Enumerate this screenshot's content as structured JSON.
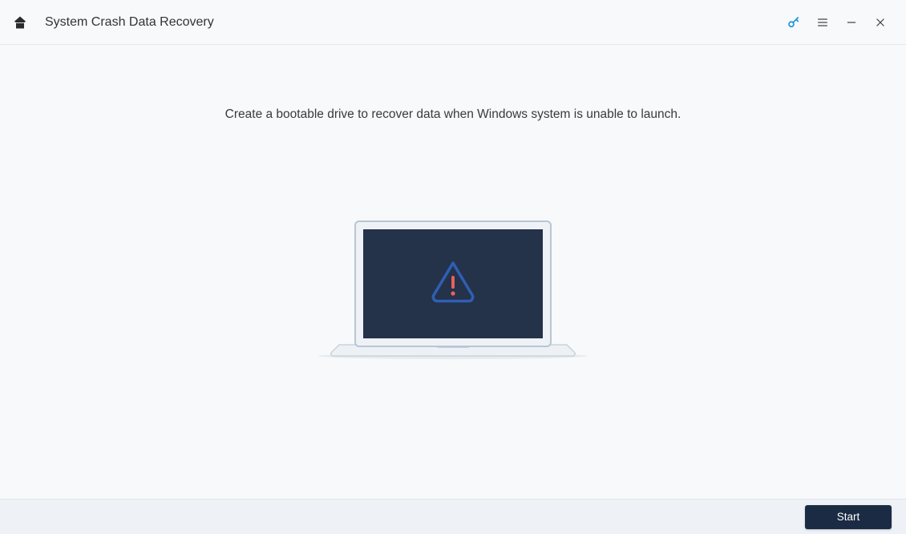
{
  "titlebar": {
    "title": "System Crash Data Recovery"
  },
  "main": {
    "subtitle": "Create a bootable drive to recover data when Windows system is unable to launch."
  },
  "footer": {
    "start_label": "Start"
  },
  "colors": {
    "accent_blue": "#1e8fe1",
    "dark_navy": "#1b2b44",
    "warning_red": "#e8615f"
  }
}
